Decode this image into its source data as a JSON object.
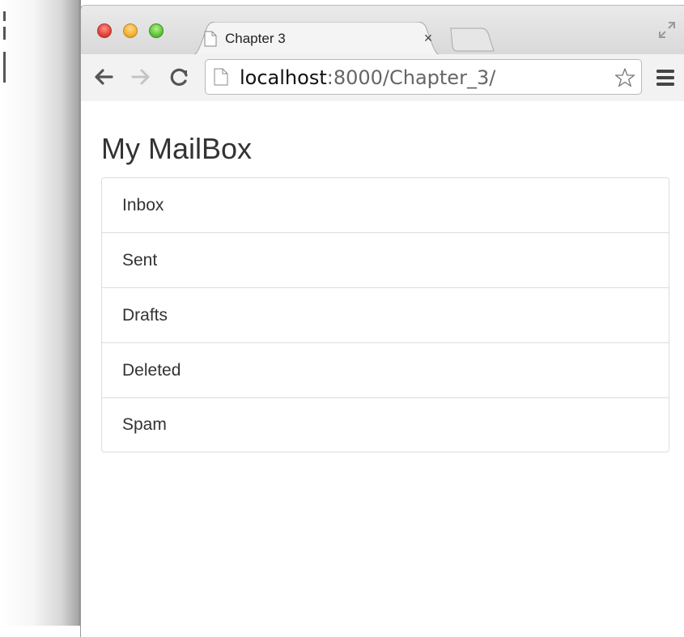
{
  "browser": {
    "tab_title": "Chapter 3",
    "tab_close": "×",
    "url_host": "localhost",
    "url_path": ":8000/Chapter_3/"
  },
  "icons": {
    "back": "back-arrow-icon",
    "forward": "forward-arrow-icon",
    "reload": "reload-icon",
    "page": "page-icon",
    "bookmark": "star-icon",
    "menu": "hamburger-menu-icon",
    "fullscreen": "fullscreen-icon"
  },
  "colors": {
    "close": "#e0443a",
    "minimize": "#f2b135",
    "maximize": "#5fc43c",
    "list_border": "#dddddd",
    "text": "#333333"
  },
  "page": {
    "title": "My MailBox",
    "mailboxes": [
      {
        "label": "Inbox"
      },
      {
        "label": "Sent"
      },
      {
        "label": "Drafts"
      },
      {
        "label": "Deleted"
      },
      {
        "label": "Spam"
      }
    ]
  }
}
